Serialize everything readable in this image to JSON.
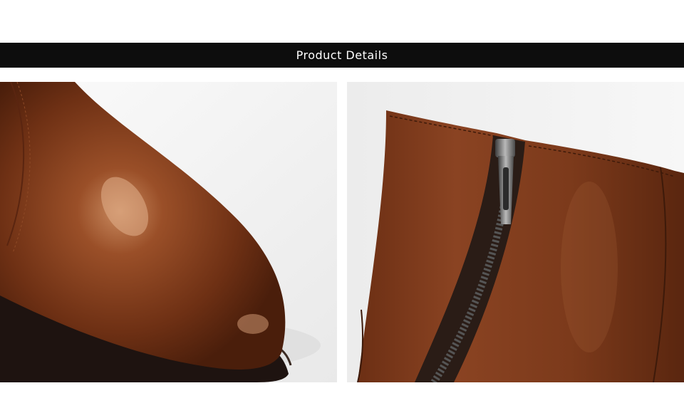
{
  "header": {
    "title": "Product Details",
    "bar_color": "#0d0d0d"
  },
  "photos": [
    {
      "subject": "boot-toe-closeup-image",
      "leather_color": "#7a3a1c"
    },
    {
      "subject": "boot-zipper-closeup-image",
      "leather_color": "#7a3a1c"
    }
  ]
}
